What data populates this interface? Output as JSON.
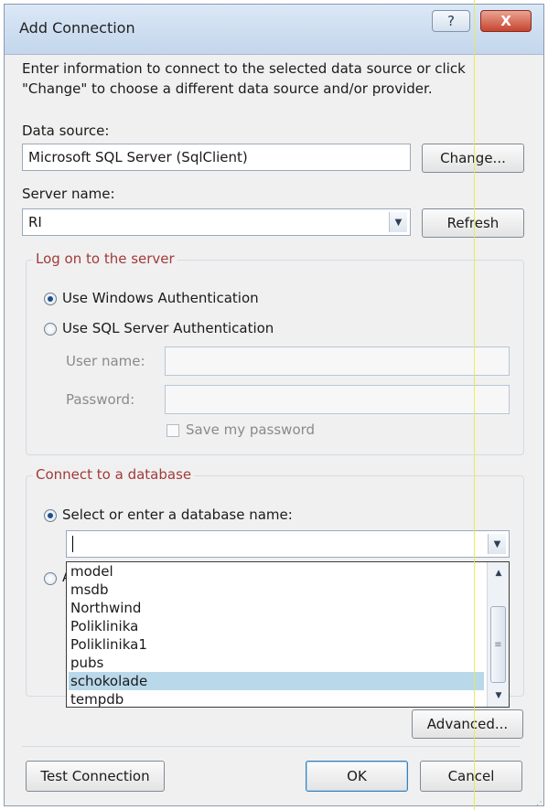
{
  "window": {
    "title": "Add Connection",
    "help_glyph": "?",
    "close_glyph": "X"
  },
  "description": "Enter information to connect to the selected data source or click \"Change\" to choose a different data source and/or provider.",
  "data_source": {
    "label": "Data source:",
    "value": "Microsoft SQL Server (SqlClient)",
    "change_label": "Change..."
  },
  "server": {
    "label": "Server name:",
    "value": "RI",
    "refresh_label": "Refresh"
  },
  "logon": {
    "title": "Log on to the server",
    "windows_auth": "Use Windows Authentication",
    "sql_auth": "Use SQL Server Authentication",
    "username_label": "User name:",
    "password_label": "Password:",
    "save_password": "Save my password"
  },
  "database": {
    "title": "Connect to a database",
    "select_label": "Select or enter a database name:",
    "input_value": "",
    "attach_partial": "A",
    "items": [
      "model",
      "msdb",
      "Northwind",
      "Poliklinika",
      "Poliklinika1",
      "pubs",
      "schokolade",
      "tempdb"
    ],
    "selected": "schokolade"
  },
  "buttons": {
    "advanced": "Advanced...",
    "test": "Test Connection",
    "ok": "OK",
    "cancel": "Cancel"
  },
  "icons": {
    "dropdown": "▼",
    "scroll_up": "▲",
    "scroll_down": "▼",
    "thumb_grip": "≡",
    "resize_grip": "⋰"
  }
}
